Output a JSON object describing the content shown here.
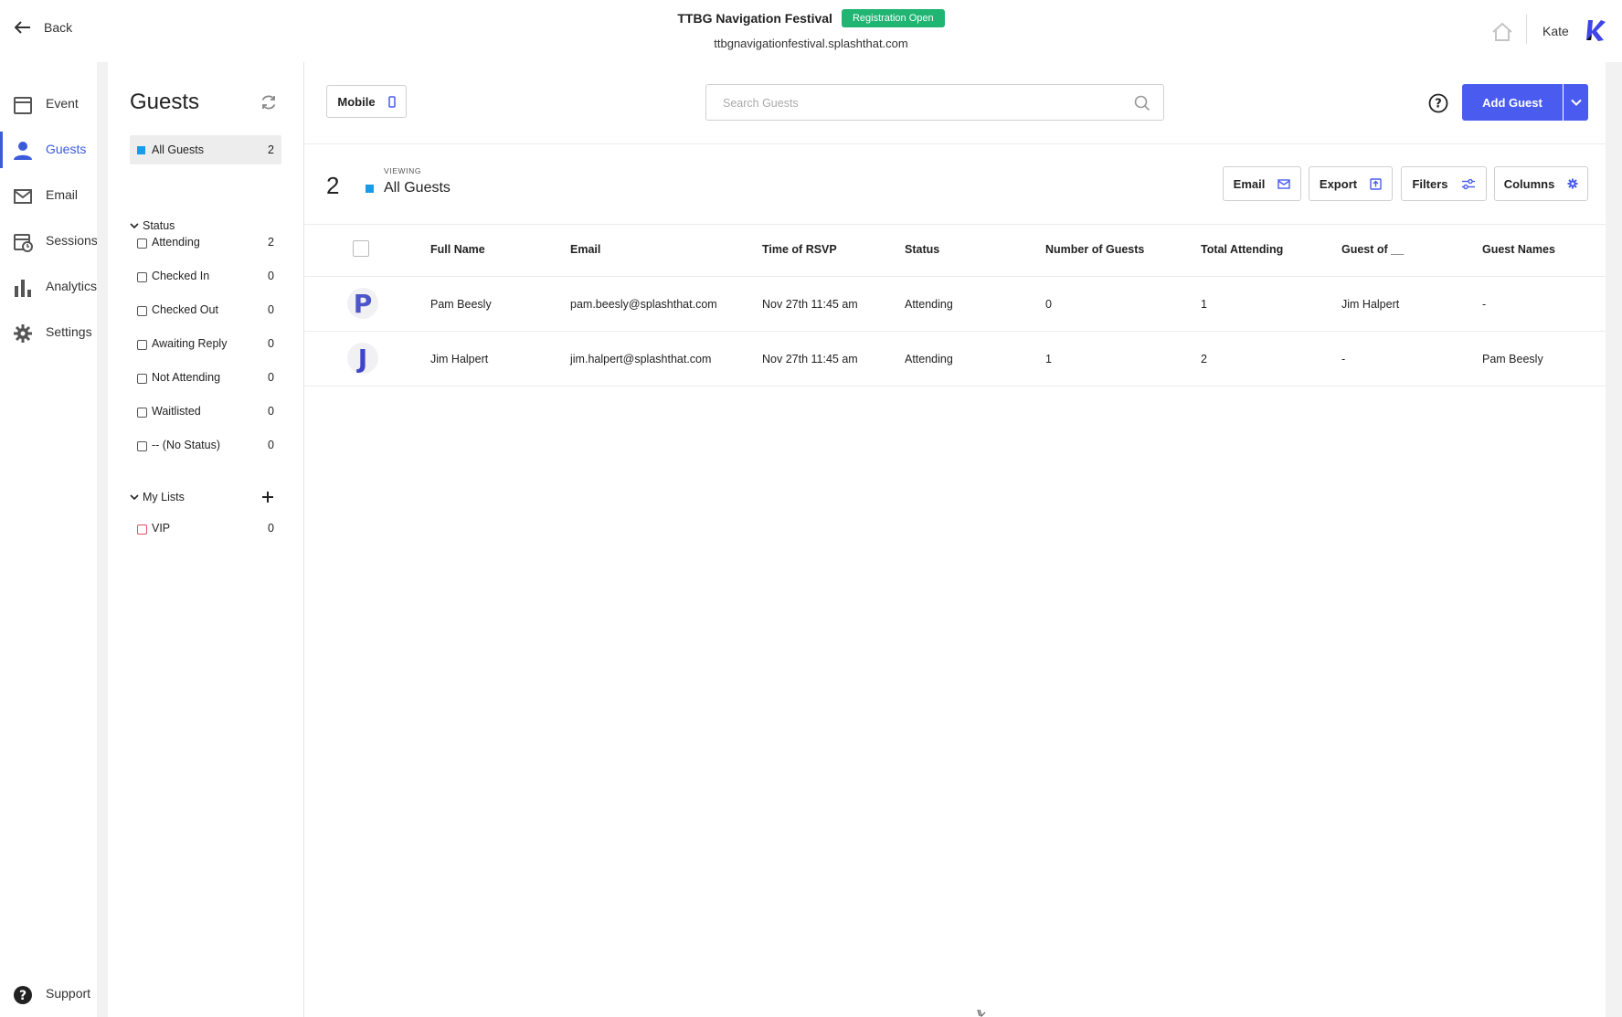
{
  "topbar": {
    "back_label": "Back",
    "event_name": "TTBG Navigation Festival",
    "registration_badge": "Registration Open",
    "event_url": "ttbgnavigationfestival.splashthat.com",
    "user_name": "Kate"
  },
  "nav": {
    "items": [
      {
        "label": "Event",
        "icon": "calendar-icon"
      },
      {
        "label": "Guests",
        "icon": "person-icon",
        "active": true
      },
      {
        "label": "Email",
        "icon": "envelope-icon"
      },
      {
        "label": "Sessions",
        "icon": "sessions-icon"
      },
      {
        "label": "Analytics",
        "icon": "bar-chart-icon"
      },
      {
        "label": "Settings",
        "icon": "gear-icon"
      }
    ],
    "support_label": "Support"
  },
  "panel": {
    "title": "Guests",
    "all_guests": {
      "label": "All Guests",
      "count": "2"
    },
    "status_section": "Status",
    "statuses": [
      {
        "label": "Attending",
        "count": "2"
      },
      {
        "label": "Checked In",
        "count": "0"
      },
      {
        "label": "Checked Out",
        "count": "0"
      },
      {
        "label": "Awaiting Reply",
        "count": "0"
      },
      {
        "label": "Not Attending",
        "count": "0"
      },
      {
        "label": "Waitlisted",
        "count": "0"
      },
      {
        "label": "-- (No Status)",
        "count": "0"
      }
    ],
    "lists_section": "My Lists",
    "lists": [
      {
        "label": "VIP",
        "count": "0"
      }
    ]
  },
  "toolbar": {
    "mobile_label": "Mobile",
    "search_placeholder": "Search Guests",
    "add_guest_label": "Add Guest"
  },
  "viewing": {
    "count": "2",
    "caption": "VIEWING",
    "list_name": "All Guests"
  },
  "actions": {
    "email": "Email",
    "export": "Export",
    "filters": "Filters",
    "columns": "Columns"
  },
  "table": {
    "columns": [
      "Full Name",
      "Email",
      "Time of RSVP",
      "Status",
      "Number of Guests",
      "Total Attending",
      "Guest of __",
      "Guest Names"
    ],
    "rows": [
      {
        "avatar": "P",
        "name": "Pam Beesly",
        "email": "pam.beesly@splashthat.com",
        "rsvp": "Nov 27th 11:45 am",
        "status": "Attending",
        "num_guests": "0",
        "total": "1",
        "guest_of": "Jim Halpert",
        "guest_names": "-"
      },
      {
        "avatar": "J",
        "name": "Jim Halpert",
        "email": "jim.halpert@splashthat.com",
        "rsvp": "Nov 27th 11:45 am",
        "status": "Attending",
        "num_guests": "1",
        "total": "2",
        "guest_of": "-",
        "guest_names": "Pam Beesly"
      }
    ]
  },
  "colors": {
    "accent": "#4a5cf0",
    "nav_active": "#3b5bdb",
    "badge_green": "#21b573",
    "list_blue": "#1a9be8",
    "vip_red": "#e0506a"
  }
}
